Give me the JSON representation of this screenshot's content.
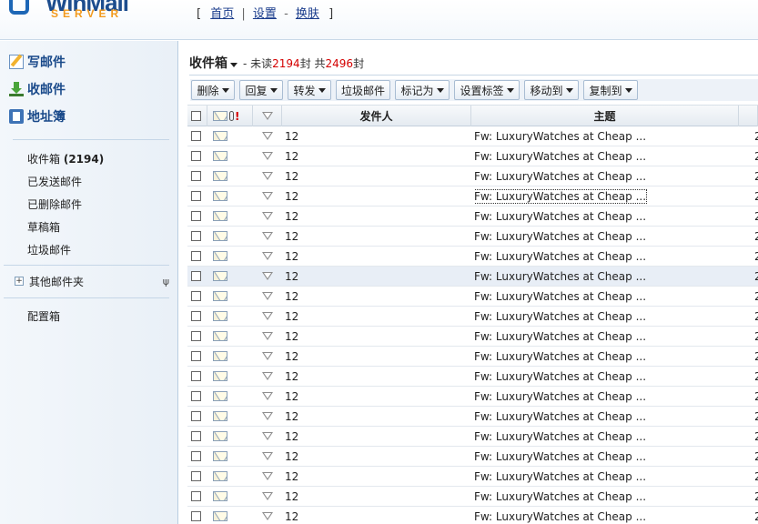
{
  "header": {
    "logo_top": "WinMail",
    "logo_bottom": "SERVER",
    "nav": [
      {
        "label": "首页"
      },
      {
        "label": "设置"
      },
      {
        "label": "换肤"
      }
    ],
    "bracket_open": "[",
    "bracket_close": "]",
    "sep1": "|",
    "sep2": "-"
  },
  "sidebar": {
    "quick": [
      {
        "label": "写邮件",
        "icon": "compose-icon"
      },
      {
        "label": "收邮件",
        "icon": "receive-icon"
      },
      {
        "label": "地址簿",
        "icon": "address-book-icon"
      }
    ],
    "folders": [
      {
        "label": "收件箱",
        "count": "(2194)"
      },
      {
        "label": "已发送邮件"
      },
      {
        "label": "已删除邮件"
      },
      {
        "label": "草稿箱"
      },
      {
        "label": "垃圾邮件"
      }
    ],
    "other_folders": "其他邮件夹",
    "other_folders_pin": "ψ",
    "config": "配置箱"
  },
  "main": {
    "title": "收件箱",
    "stats_prefix": "- 未读",
    "unread": "2194",
    "stats_mid": "封 共",
    "total": "2496",
    "stats_suffix": "封",
    "toolbar": [
      {
        "label": "删除",
        "dropdown": true
      },
      {
        "label": "回复",
        "dropdown": true
      },
      {
        "label": "转发",
        "dropdown": true
      },
      {
        "label": "垃圾邮件",
        "dropdown": false
      },
      {
        "label": "标记为",
        "dropdown": true
      },
      {
        "label": "设置标签",
        "dropdown": true
      },
      {
        "label": "移动到",
        "dropdown": true
      },
      {
        "label": "复制到",
        "dropdown": true
      }
    ],
    "columns": {
      "sender": "发件人",
      "subject": "主题",
      "priority_mark": "!"
    },
    "rows_sender": "12",
    "rows_subject": "Fw: LuxuryWatches at Cheap ...",
    "rows_date_fragment": "2",
    "row_count": 20,
    "highlighted_row": 7,
    "focused_row": 3
  },
  "colors": {
    "accent": "#1a4a8a",
    "unread_red": "#d40000",
    "logo_orange": "#f29a1e"
  }
}
